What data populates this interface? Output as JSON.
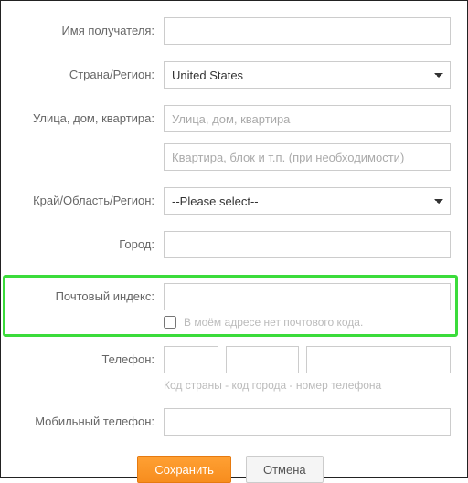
{
  "labels": {
    "recipient": "Имя получателя:",
    "country": "Страна/Регион:",
    "street": "Улица, дом, квартира:",
    "region": "Край/Область/Регион:",
    "city": "Город:",
    "postal": "Почтовый индекс:",
    "phone": "Телефон:",
    "mobile": "Мобильный телефон:"
  },
  "placeholders": {
    "street1": "Улица, дом, квартира",
    "street2": "Квартира, блок и т.п. (при необходимости)"
  },
  "country_value": "United States",
  "region_value": "--Please select--",
  "postal_checkbox": "В моём адресе нет почтового кода.",
  "phone_hint": "Код страны - код города - номер телефона",
  "buttons": {
    "save": "Сохранить",
    "cancel": "Отмена"
  }
}
